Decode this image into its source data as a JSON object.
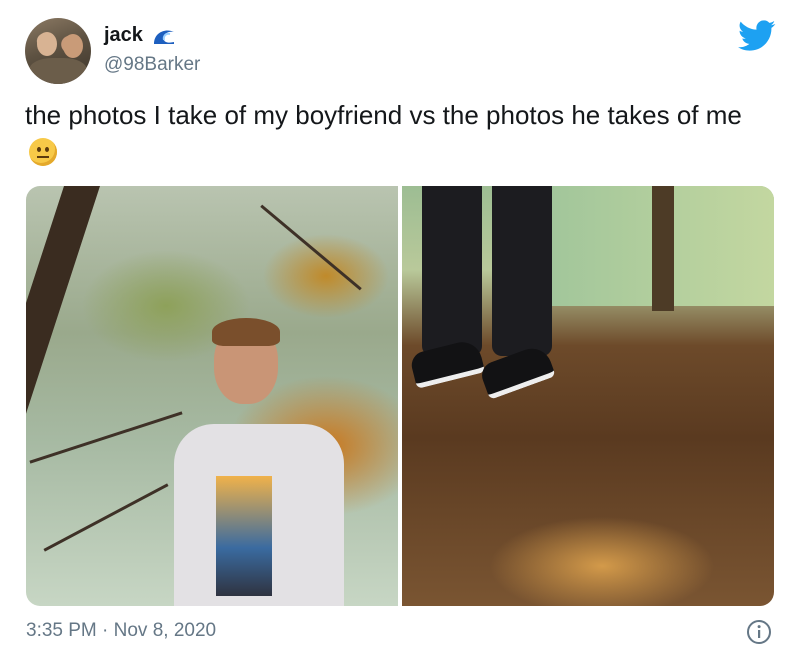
{
  "tweet": {
    "display_name": "jack",
    "handle": "@98Barker",
    "text": "the photos I take of my boyfriend vs the photos he takes of me",
    "emoji": "neutral-face",
    "timestamp": "3:35 PM · Nov 8, 2020"
  },
  "media": {
    "photos": [
      {
        "name": "photo-boyfriend"
      },
      {
        "name": "photo-me"
      }
    ]
  },
  "colors": {
    "text": "#14171a",
    "secondary": "#657786",
    "twitter_blue": "#1da1f2"
  },
  "icons": {
    "badge": "wave-icon",
    "brand": "twitter-bird-icon",
    "info": "info-icon"
  }
}
